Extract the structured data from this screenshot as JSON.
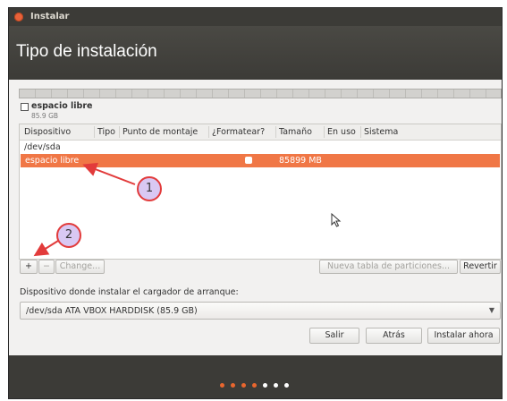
{
  "window": {
    "title": "Instalar"
  },
  "header": {
    "title": "Tipo de instalación"
  },
  "legend": {
    "name": "espacio libre",
    "size": "85.9 GB"
  },
  "table": {
    "columns": [
      "Dispositivo",
      "Tipo",
      "Punto de montaje",
      "¿Formatear?",
      "Tamaño",
      "En uso",
      "Sistema"
    ],
    "device": "/dev/sda",
    "selected_row": {
      "device": "espacio libre",
      "formatear": false,
      "size": "85899 MB"
    }
  },
  "annotations": [
    "1",
    "2"
  ],
  "toolbar": {
    "add": "+",
    "remove": "−",
    "change": "Change...",
    "new_table": "Nueva tabla de particiones...",
    "revert": "Revertir"
  },
  "bootloader": {
    "label": "Dispositivo donde instalar el cargador de arranque:",
    "selected": "/dev/sda  ATA VBOX HARDDISK (85.9 GB)"
  },
  "actions": {
    "quit": "Salir",
    "back": "Atrás",
    "install": "Instalar ahora"
  },
  "progress": {
    "total_steps": 7,
    "completed_steps": 4,
    "colors": {
      "done": "#e9662e",
      "todo": "#ffffff"
    }
  },
  "colors": {
    "selection": "#f07746",
    "titlebar": "#3c3b37",
    "annotation_fill": "#d9c8f3",
    "annotation_stroke": "#e23b3b"
  }
}
